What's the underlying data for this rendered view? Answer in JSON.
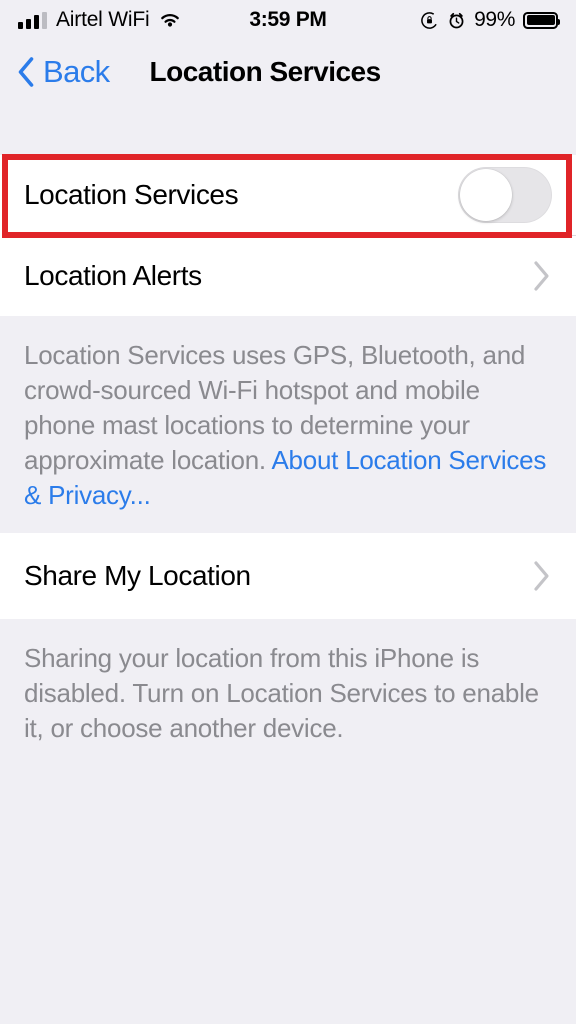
{
  "status_bar": {
    "carrier": "Airtel WiFi",
    "time": "3:59 PM",
    "battery_percent": "99%",
    "signal_icon": "signal-bars-icon",
    "wifi_icon": "wifi-icon",
    "rotation_lock_icon": "rotation-lock-icon",
    "alarm_icon": "alarm-clock-icon",
    "battery_icon": "battery-icon"
  },
  "nav": {
    "back_label": "Back",
    "title": "Location Services",
    "back_icon": "chevron-left-icon"
  },
  "sections": {
    "location_services_row": {
      "label": "Location Services",
      "toggle_state": "off"
    },
    "location_alerts_row": {
      "label": "Location Alerts",
      "disclosure_icon": "chevron-right-icon"
    },
    "location_footer": {
      "text": "Location Services uses GPS, Bluetooth, and crowd-sourced Wi-Fi hotspot and mobile phone mast locations to determine your approximate location. ",
      "link": "About Location Services & Privacy..."
    },
    "share_my_location_row": {
      "label": "Share My Location",
      "disclosure_icon": "chevron-right-icon"
    },
    "share_footer": {
      "text": "Sharing your location from this iPhone is disabled. Turn on Location Services to enable it, or choose another device."
    }
  },
  "annotation": {
    "highlight_color": "#e02428",
    "target": "location-services-toggle-row"
  },
  "colors": {
    "accent_blue": "#2b7cea",
    "background": "#f0eff4",
    "card": "#ffffff",
    "secondary_text": "#8a8a8f",
    "toggle_off_track": "#e6e5e8"
  }
}
